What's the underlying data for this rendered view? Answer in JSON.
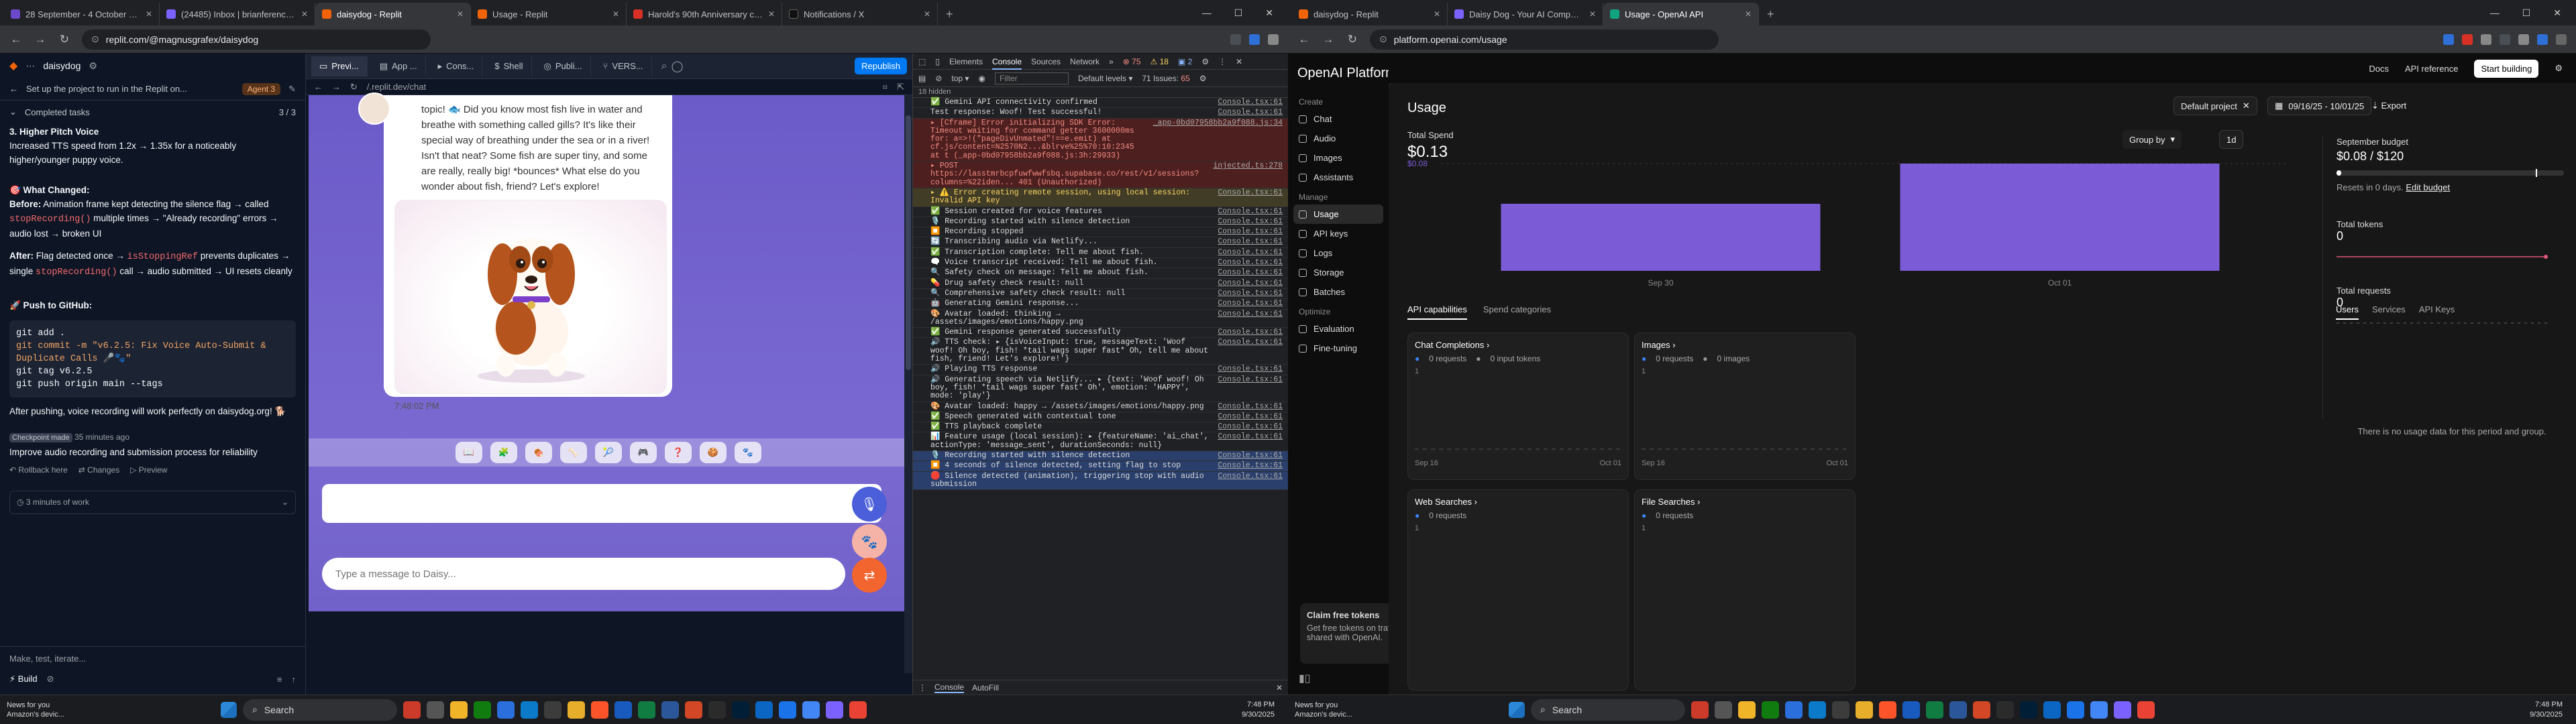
{
  "left": {
    "tabs": [
      {
        "label": "28 September - 4 October 2025 – Pr",
        "color": "#6b49c9"
      },
      {
        "label": "(24485) Inbox | brianference@prote",
        "color": "#7b61ff"
      },
      {
        "label": "daisydog - Replit",
        "color": "#f26207",
        "active": true
      },
      {
        "label": "Usage - Replit",
        "color": "#f26207"
      },
      {
        "label": "Harold's 90th Anniversary concert ti",
        "color": "#d93025"
      },
      {
        "label": "Notifications / X",
        "color": "#111"
      }
    ],
    "url": "replit.com/@magnusgrafex/daisydog",
    "replit": {
      "project": "daisydog",
      "task_banner": "Set up the project to run in the Replit on...",
      "agent_label": "Agent 3",
      "completed_tasks": "Completed tasks",
      "completed_count": "3 / 3",
      "section3_title": "3. Higher Pitch Voice",
      "section3_text": "Increased TTS speed from 1.2x → 1.35x for a noticeably higher/younger puppy voice.",
      "what_changed": "🎯 What Changed:",
      "before_label": "Before:",
      "before_text": "Animation frame kept detecting the silence flag → called",
      "before_code": "stopRecording()",
      "before_text2": "multiple times → \"Already recording\" errors → audio lost → broken UI",
      "after_label": "After:",
      "after_text": "Flag detected once →",
      "after_code": "isStoppingRef",
      "after_text2": "prevents duplicates → single",
      "after_code2": "stopRecording()",
      "after_text3": "call → audio submitted → UI resets cleanly",
      "push_title": "🚀 Push to GitHub:",
      "git_lines": [
        "git add .",
        "git commit -m \"v6.2.5: Fix Voice Auto-Submit & Duplicate Calls 🎤🐾\"",
        "git tag v6.2.5",
        "git push origin main --tags"
      ],
      "after_push": "After pushing, voice recording will work perfectly on daisydog.org! 🐕",
      "checkpoint_badge": "Checkpoint made",
      "checkpoint_time": "35 minutes ago",
      "checkpoint_text": "Improve audio recording and submission process for reliability",
      "rollback": "Rollback here",
      "changes": "Changes",
      "preview": "Preview",
      "work_time": "3 minutes of work",
      "input_placeholder": "Make, test, iterate...",
      "build_label": "Build"
    },
    "workspace_tabs": [
      "Previ...",
      "App ...",
      "Cons...",
      "Shell",
      "Publi...",
      "VERS..."
    ],
    "republish": "Republish",
    "preview_url": "/.replit.dev/chat",
    "daisy": {
      "message": "topic! 🐟 Did you know most fish live in water and breathe with something called gills? It's like their special way of breathing under the sea or in a river! Isn't that neat? Some fish are super tiny, and some are really, really big! *bounces* What else do you wonder about fish, friend? Let's explore!",
      "time": "7:48:02 PM",
      "input_placeholder": "Type a message to Daisy..."
    },
    "devtools": {
      "tabs": [
        "Elements",
        "Console",
        "Sources",
        "Network"
      ],
      "errors": "75",
      "warnings": "18",
      "info": "2",
      "context": "top",
      "filter_placeholder": "Filter",
      "levels": "Default levels",
      "issues": "71 Issues:",
      "issues_count": "65",
      "hidden": "18 hidden",
      "drawer_tabs": [
        "Console",
        "AutoFill"
      ]
    },
    "console": [
      {
        "t": "✅ Gemini API connectivity confirmed",
        "s": "Console.tsx:61",
        "k": "log"
      },
      {
        "t": "Test response: Woof! Test successful!",
        "s": "Console.tsx:61",
        "k": "log"
      },
      {
        "t": "▸ [Cframe] Error initializing SDK Error: Timeout waiting for command getter 3600000ms for: a=>!(\"pageDivUnmated\"!==e.emit) at cf.js/content=N2570N2...&blrve%25%70:10:2345 at t (_app-0bd07958bb2a9f088.js:3h:29933)",
        "s": "_app-0bd07958bb2a9f088.js:34",
        "k": "err"
      },
      {
        "t": "▸ POST https://lasstmrbcpfuwfwwfsbq.supabase.co/rest/v1/sessions?columns=%22iden... 401 (Unauthorized)",
        "s": "injected.ts:278",
        "k": "err"
      },
      {
        "t": "▸ ⚠️ Error creating remote session, using local session: Invalid API key",
        "s": "Console.tsx:61",
        "k": "warn"
      },
      {
        "t": "✅ Session created for voice features",
        "s": "Console.tsx:61",
        "k": "log"
      },
      {
        "t": "🎙️ Recording started with silence detection",
        "s": "Console.tsx:61",
        "k": "log"
      },
      {
        "t": "⏹️ Recording stopped",
        "s": "Console.tsx:61",
        "k": "log"
      },
      {
        "t": "🔄 Transcribing audio via Netlify...",
        "s": "Console.tsx:61",
        "k": "log"
      },
      {
        "t": "✅ Transcription complete: Tell me about fish.",
        "s": "Console.tsx:61",
        "k": "log"
      },
      {
        "t": "🗨️ Voice transcript received: Tell me about fish.",
        "s": "Console.tsx:61",
        "k": "log"
      },
      {
        "t": "🔍 Safety check on message: Tell me about fish.",
        "s": "Console.tsx:61",
        "k": "log"
      },
      {
        "t": "💊 Drug safety check result: null",
        "s": "Console.tsx:61",
        "k": "log"
      },
      {
        "t": "🔍 Comprehensive safety check result: null",
        "s": "Console.tsx:61",
        "k": "log"
      },
      {
        "t": "🤖 Generating Gemini response...",
        "s": "Console.tsx:61",
        "k": "log"
      },
      {
        "t": "🎨 Avatar loaded: thinking → /assets/images/emotions/happy.png",
        "s": "Console.tsx:61",
        "k": "log"
      },
      {
        "t": "✅ Gemini response generated successfully",
        "s": "Console.tsx:61",
        "k": "log"
      },
      {
        "t": "🔊 TTS check: ▸ {isVoiceInput: true, messageText: 'Woof woof! Oh boy, fish! *tail wags super fast* Oh, tell me about fish, friend! Let's explore!'}",
        "s": "Console.tsx:61",
        "k": "log"
      },
      {
        "t": "🔊 Playing TTS response",
        "s": "Console.tsx:61",
        "k": "log"
      },
      {
        "t": "🔊 Generating speech via Netlify... ▸ {text: 'Woof woof! Oh boy, fish! *tail wags super fast* Oh', emotion: 'HAPPY', mode: 'play'}",
        "s": "Console.tsx:61",
        "k": "log"
      },
      {
        "t": "🎨 Avatar loaded: happy → /assets/images/emotions/happy.png",
        "s": "Console.tsx:61",
        "k": "log"
      },
      {
        "t": "✅ Speech generated with contextual tone",
        "s": "Console.tsx:61",
        "k": "log"
      },
      {
        "t": "✅ TTS playback complete",
        "s": "Console.tsx:61",
        "k": "log"
      },
      {
        "t": "📊 Feature usage (local session): ▸ {featureName: 'ai_chat', actionType: 'message_sent', durationSeconds: null}",
        "s": "Console.tsx:61",
        "k": "log"
      },
      {
        "t": "🎙️ Recording started with silence detection",
        "s": "Console.tsx:61",
        "k": "sel"
      },
      {
        "t": "⏹️ 4 seconds of silence detected, setting flag to stop",
        "s": "Console.tsx:61",
        "k": "sel"
      },
      {
        "t": "🛑 Silence detected (animation), triggering stop with audio submission",
        "s": "Console.tsx:61",
        "k": "sel"
      }
    ],
    "taskbar": {
      "news": "News for you",
      "news_sub": "Amazon's devic...",
      "search": "Search",
      "time": "7:48 PM",
      "date": "9/30/2025"
    }
  },
  "right": {
    "tabs": [
      {
        "label": "daisydog - Replit",
        "color": "#f26207"
      },
      {
        "label": "Daisy Dog - Your AI Companion",
        "color": "#7b61ff"
      },
      {
        "label": "Usage - OpenAI API",
        "color": "#10a37f",
        "active": true
      }
    ],
    "url": "platform.openai.com/usage",
    "openai": {
      "brand": "OpenAI Platform",
      "create": "Create",
      "create_items": [
        "Chat",
        "Audio",
        "Images",
        "Assistants"
      ],
      "manage": "Manage",
      "manage_items": [
        "Usage",
        "API keys",
        "Logs",
        "Storage",
        "Batches"
      ],
      "optimize": "Optimize",
      "optimize_items": [
        "Evaluation",
        "Fine-tuning"
      ],
      "header_links": [
        "Docs",
        "API reference"
      ],
      "start_building": "Start building",
      "title": "Usage",
      "project": "Default project",
      "date_range": "09/16/25 - 10/01/25",
      "export": "Export",
      "total_spend_label": "Total Spend",
      "total_spend": "$0.13",
      "spend_axis": "$0.08",
      "group_by": "Group by",
      "granularity": "1d",
      "claim_title": "Claim free tokens",
      "claim_text": "Get free tokens on traffic shared with OpenAI.",
      "budget_label": "September budget",
      "budget_value": "$0.08 / $120",
      "budget_used_fraction": 0.0007,
      "budget_reset": "Resets in 0 days.",
      "edit_budget": "Edit budget",
      "total_tokens_label": "Total tokens",
      "total_tokens": "0",
      "total_requests_label": "Total requests",
      "total_requests": "0",
      "subtabs": [
        "API capabilities",
        "Spend categories"
      ],
      "right_tabs": [
        "Users",
        "Services",
        "API Keys"
      ],
      "no_data": "There is no usage data for this period and group.",
      "cards": [
        {
          "title": "Chat Completions",
          "stat1": "0 requests",
          "stat2": "0 input tokens",
          "axis": "1",
          "xstart": "Sep 16",
          "xend": "Oct 01"
        },
        {
          "title": "Images",
          "stat1": "0 requests",
          "stat2": "0 images",
          "axis": "1",
          "xstart": "Sep 16",
          "xend": "Oct 01"
        },
        {
          "title": "Web Searches",
          "stat1": "0 requests",
          "axis": "1"
        },
        {
          "title": "File Searches",
          "stat1": "0 requests",
          "axis": "1"
        }
      ]
    },
    "taskbar": {
      "news": "News for you",
      "news_sub": "Amazon's devic...",
      "search": "Search",
      "time": "7:48 PM",
      "date": "9/30/2025"
    }
  },
  "chart_data": {
    "type": "bar",
    "categories": [
      "Sep 30",
      "Oct 01"
    ],
    "values": [
      0.05,
      0.08
    ],
    "xlabel": "",
    "ylabel": "",
    "ylim": [
      0,
      0.08
    ],
    "color": "#7c5cd6"
  }
}
